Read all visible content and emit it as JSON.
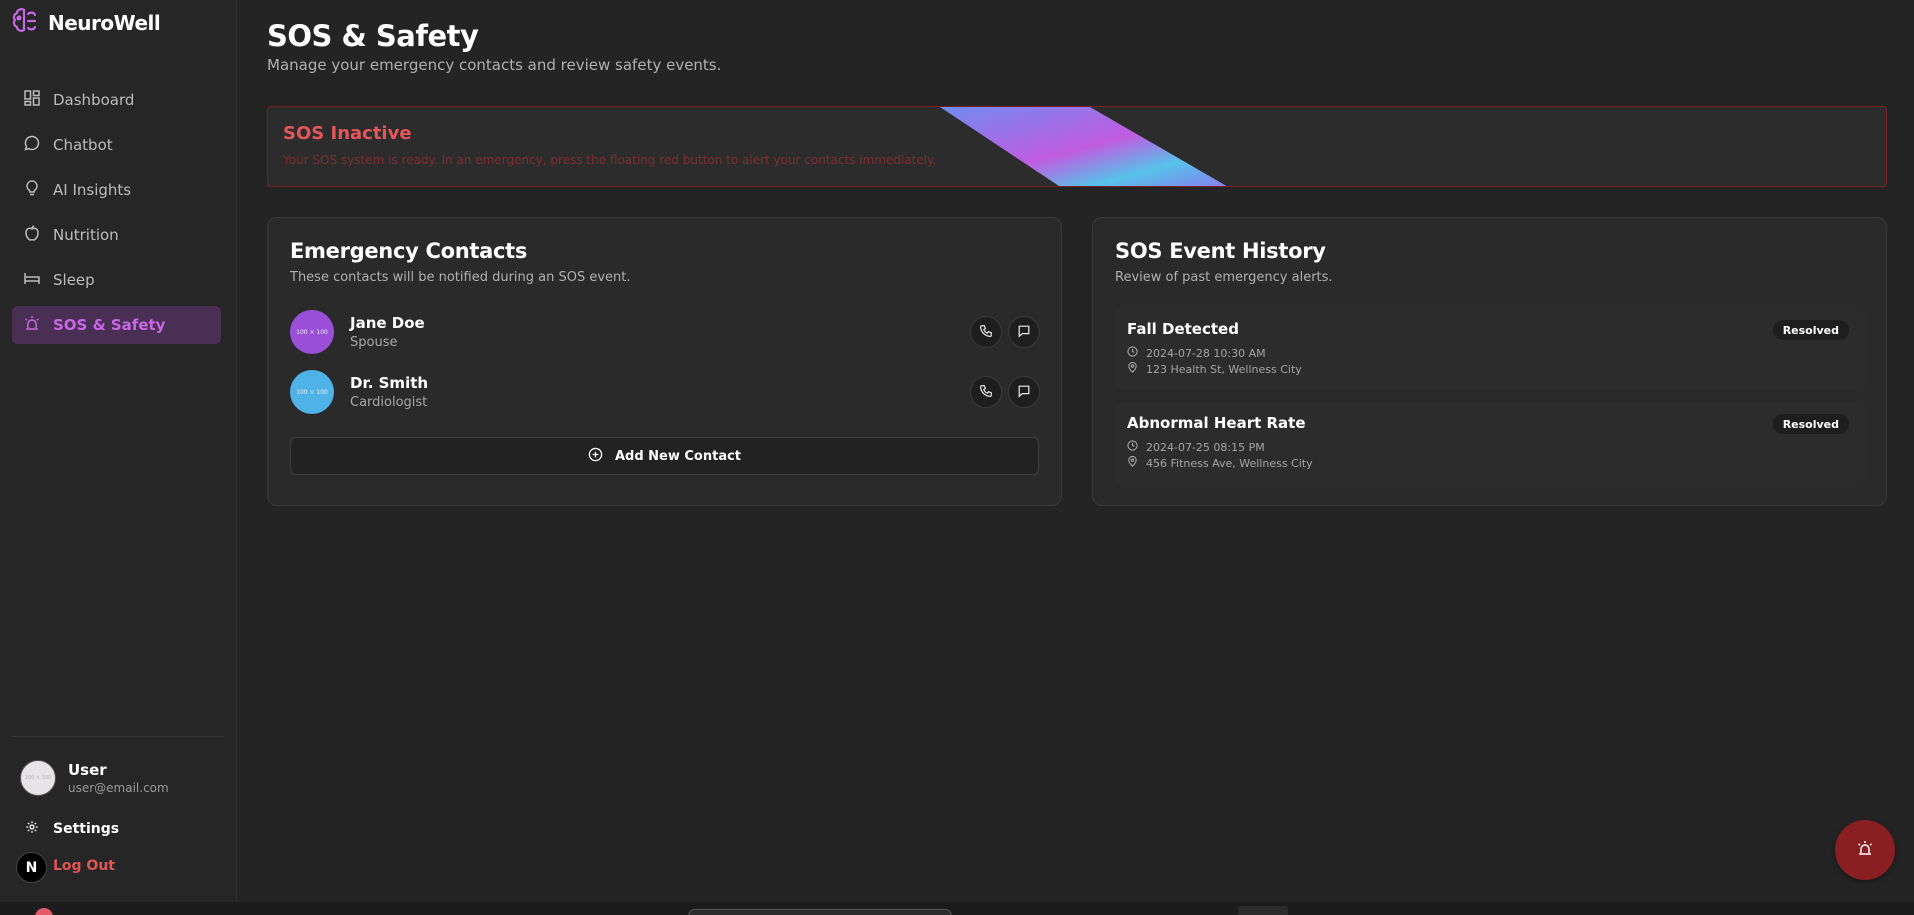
{
  "app": {
    "name": "NeuroWell"
  },
  "sidebar": {
    "items": [
      {
        "label": "Dashboard",
        "icon": "dashboard-icon"
      },
      {
        "label": "Chatbot",
        "icon": "chat-icon"
      },
      {
        "label": "AI Insights",
        "icon": "lightbulb-icon"
      },
      {
        "label": "Nutrition",
        "icon": "apple-icon"
      },
      {
        "label": "Sleep",
        "icon": "bed-icon"
      },
      {
        "label": "SOS & Safety",
        "icon": "siren-icon",
        "active": true
      }
    ],
    "user": {
      "name": "User",
      "email": "user@email.com",
      "avatar_text": "100 × 100"
    },
    "settings_label": "Settings",
    "logout_label": "Log Out",
    "badge_letter": "N"
  },
  "page": {
    "title": "SOS & Safety",
    "subtitle": "Manage your emergency contacts and review safety events."
  },
  "alert": {
    "title": "SOS Inactive",
    "text": "Your SOS system is ready. In an emergency, press the floating red button to alert your contacts immediately."
  },
  "contacts_card": {
    "title": "Emergency Contacts",
    "subtitle": "These contacts will be notified during an SOS event.",
    "contacts": [
      {
        "name": "Jane Doe",
        "role": "Spouse",
        "avatar_text": "100 × 100",
        "color": "#9b4fd8"
      },
      {
        "name": "Dr. Smith",
        "role": "Cardiologist",
        "avatar_text": "100 × 100",
        "color": "#4fb3e8"
      }
    ],
    "add_label": "Add New Contact"
  },
  "history_card": {
    "title": "SOS Event History",
    "subtitle": "Review of past emergency alerts.",
    "events": [
      {
        "title": "Fall Detected",
        "datetime": "2024-07-28 10:30 AM",
        "location": "123 Health St, Wellness City",
        "status": "Resolved"
      },
      {
        "title": "Abnormal Heart Rate",
        "datetime": "2024-07-25 08:15 PM",
        "location": "456 Fitness Ave, Wellness City",
        "status": "Resolved"
      }
    ]
  },
  "colors": {
    "accent": "#c868e6",
    "danger": "#e5565a",
    "sos_button": "#8a1f22"
  }
}
